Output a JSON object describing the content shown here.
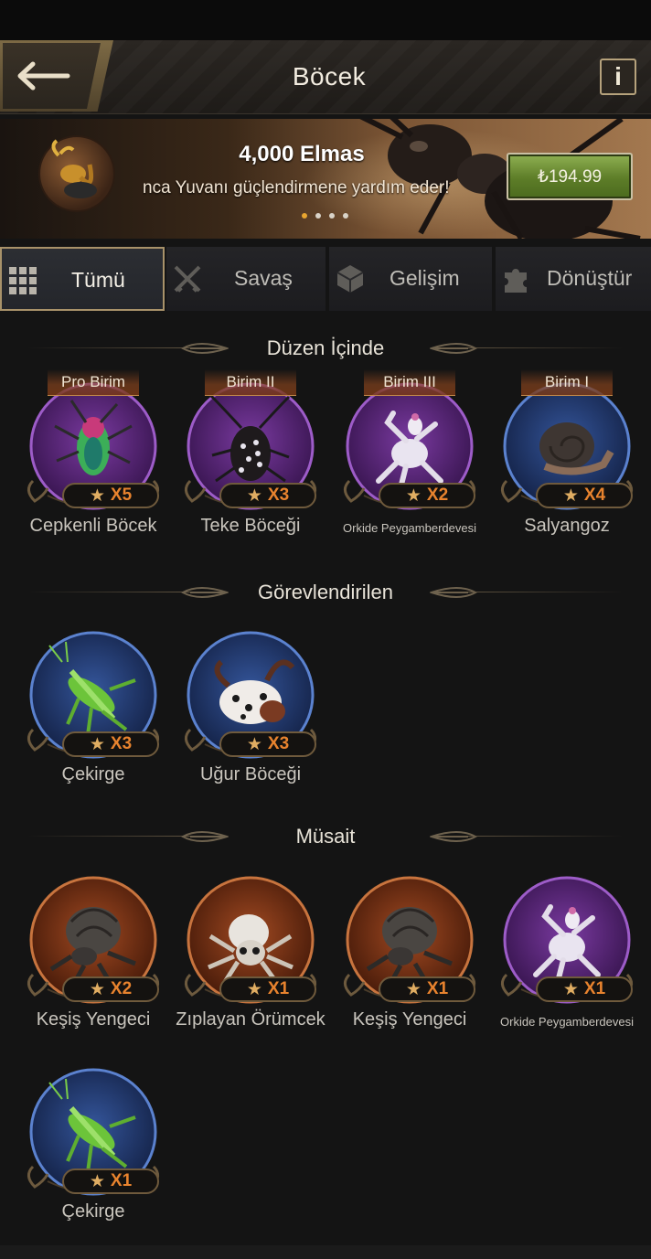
{
  "header": {
    "title": "Böcek",
    "info_label": "i"
  },
  "banner": {
    "title": "4,000 Elmas",
    "subtitle": "nca Yuvanı güçlendirmene yardım eder!",
    "price": "₺194.99",
    "dots": 4,
    "active_dot": 0
  },
  "tabs": [
    {
      "label": "Tümü",
      "icon": "grid-icon",
      "active": true
    },
    {
      "label": "Savaş",
      "icon": "crossed-swords-icon",
      "active": false
    },
    {
      "label": "Gelişim",
      "icon": "cube-icon",
      "active": false
    },
    {
      "label": "Dönüştür",
      "icon": "puzzle-icon",
      "active": false
    }
  ],
  "sections": {
    "in_formation": {
      "title": "Düzen İçinde",
      "items": [
        {
          "rank": "Pro Birim",
          "name": "Cepkenli Böcek",
          "count": "X5",
          "color": "purple",
          "art": "jewel-beetle"
        },
        {
          "rank": "Birim II",
          "name": "Teke Böceği",
          "count": "X3",
          "color": "purple",
          "art": "longhorn-beetle"
        },
        {
          "rank": "Birim III",
          "name": "Orkide Peygamberdevesi",
          "count": "X2",
          "color": "purple",
          "art": "orchid-mantis"
        },
        {
          "rank": "Birim I",
          "name": "Salyangoz",
          "count": "X4",
          "color": "blue",
          "art": "snail"
        }
      ]
    },
    "assigned": {
      "title": "Görevlendirilen",
      "items": [
        {
          "name": "Çekirge",
          "count": "X3",
          "color": "blue",
          "art": "grasshopper"
        },
        {
          "name": "Uğur Böceği",
          "count": "X3",
          "color": "blue",
          "art": "ladybug"
        }
      ]
    },
    "available": {
      "title": "Müsait",
      "items": [
        {
          "name": "Keşiş Yengeci",
          "count": "X2",
          "color": "orange",
          "art": "hermit-crab"
        },
        {
          "name": "Zıplayan Örümcek",
          "count": "X1",
          "color": "orange",
          "art": "jumping-spider"
        },
        {
          "name": "Keşiş Yengeci",
          "count": "X1",
          "color": "orange",
          "art": "hermit-crab"
        },
        {
          "name": "Orkide Peygamberdevesi",
          "count": "X1",
          "color": "purple",
          "art": "orchid-mantis"
        },
        {
          "name": "Çekirge",
          "count": "X1",
          "color": "blue",
          "art": "grasshopper"
        }
      ]
    }
  },
  "colors": {
    "purple": "#6a2e8c",
    "blue": "#2a4478",
    "orange": "#8a3d1a",
    "accent_gold": "#a8926a",
    "count_orange": "#e8832e"
  }
}
